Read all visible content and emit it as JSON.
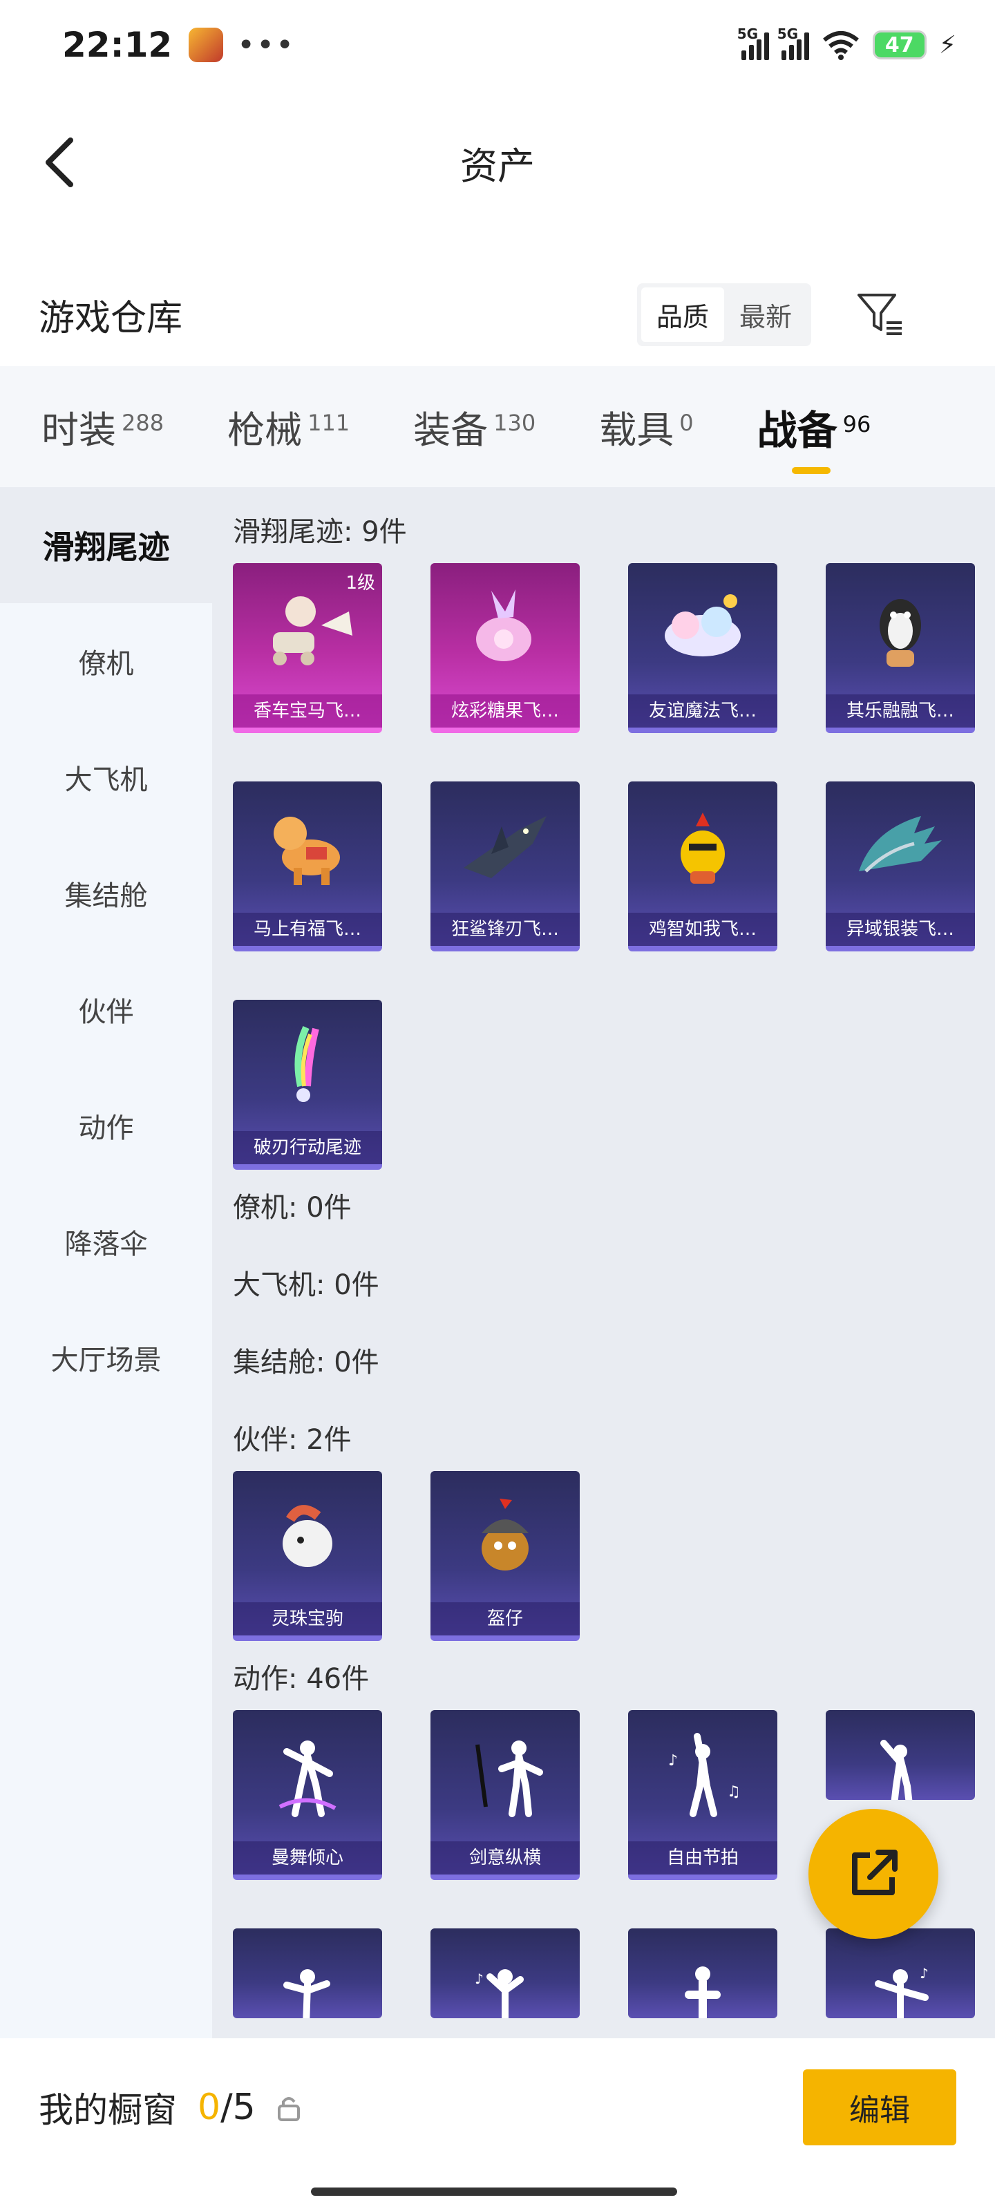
{
  "status_bar": {
    "time": "22:12",
    "dots": "•••",
    "net1": "5G",
    "net2": "5G",
    "battery": "47"
  },
  "header": {
    "title": "资产"
  },
  "warehouse": {
    "title": "游戏仓库",
    "sort_quality": "品质",
    "sort_newest": "最新"
  },
  "categories": [
    {
      "label": "时装",
      "count": "288"
    },
    {
      "label": "枪械",
      "count": "111"
    },
    {
      "label": "装备",
      "count": "130"
    },
    {
      "label": "载具",
      "count": "0"
    },
    {
      "label": "战备",
      "count": "96"
    }
  ],
  "sidebar": [
    {
      "label": "滑翔尾迹"
    },
    {
      "label": "僚机"
    },
    {
      "label": "大飞机"
    },
    {
      "label": "集结舱"
    },
    {
      "label": "伙伴"
    },
    {
      "label": "动作"
    },
    {
      "label": "降落伞"
    },
    {
      "label": "大厅场景"
    }
  ],
  "sections": {
    "glide": {
      "title": "滑翔尾迹: 9件",
      "items": [
        {
          "name": "香车宝马飞…",
          "level": "1级"
        },
        {
          "name": "炫彩糖果飞…"
        },
        {
          "name": "友谊魔法飞…"
        },
        {
          "name": "其乐融融飞…"
        },
        {
          "name": "马上有福飞…"
        },
        {
          "name": "狂鲨锋刃飞…"
        },
        {
          "name": "鸡智如我飞…"
        },
        {
          "name": "异域银装飞…"
        },
        {
          "name": "破刃行动尾迹"
        }
      ]
    },
    "wingman": {
      "title": "僚机: 0件"
    },
    "plane": {
      "title": "大飞机: 0件"
    },
    "pod": {
      "title": "集结舱: 0件"
    },
    "partner": {
      "title": "伙伴: 2件",
      "items": [
        {
          "name": "灵珠宝驹"
        },
        {
          "name": "盔仔"
        }
      ]
    },
    "action": {
      "title": "动作: 46件",
      "items": [
        {
          "name": "曼舞倾心"
        },
        {
          "name": "剑意纵横"
        },
        {
          "name": "自由节拍"
        }
      ]
    }
  },
  "bottom": {
    "title": "我的橱窗",
    "used": "0",
    "total": "/5",
    "edit": "编辑"
  },
  "colors": {
    "accent": "#f5b400",
    "card_purple": "#3c3a82",
    "card_pink": "#b92fa4"
  }
}
